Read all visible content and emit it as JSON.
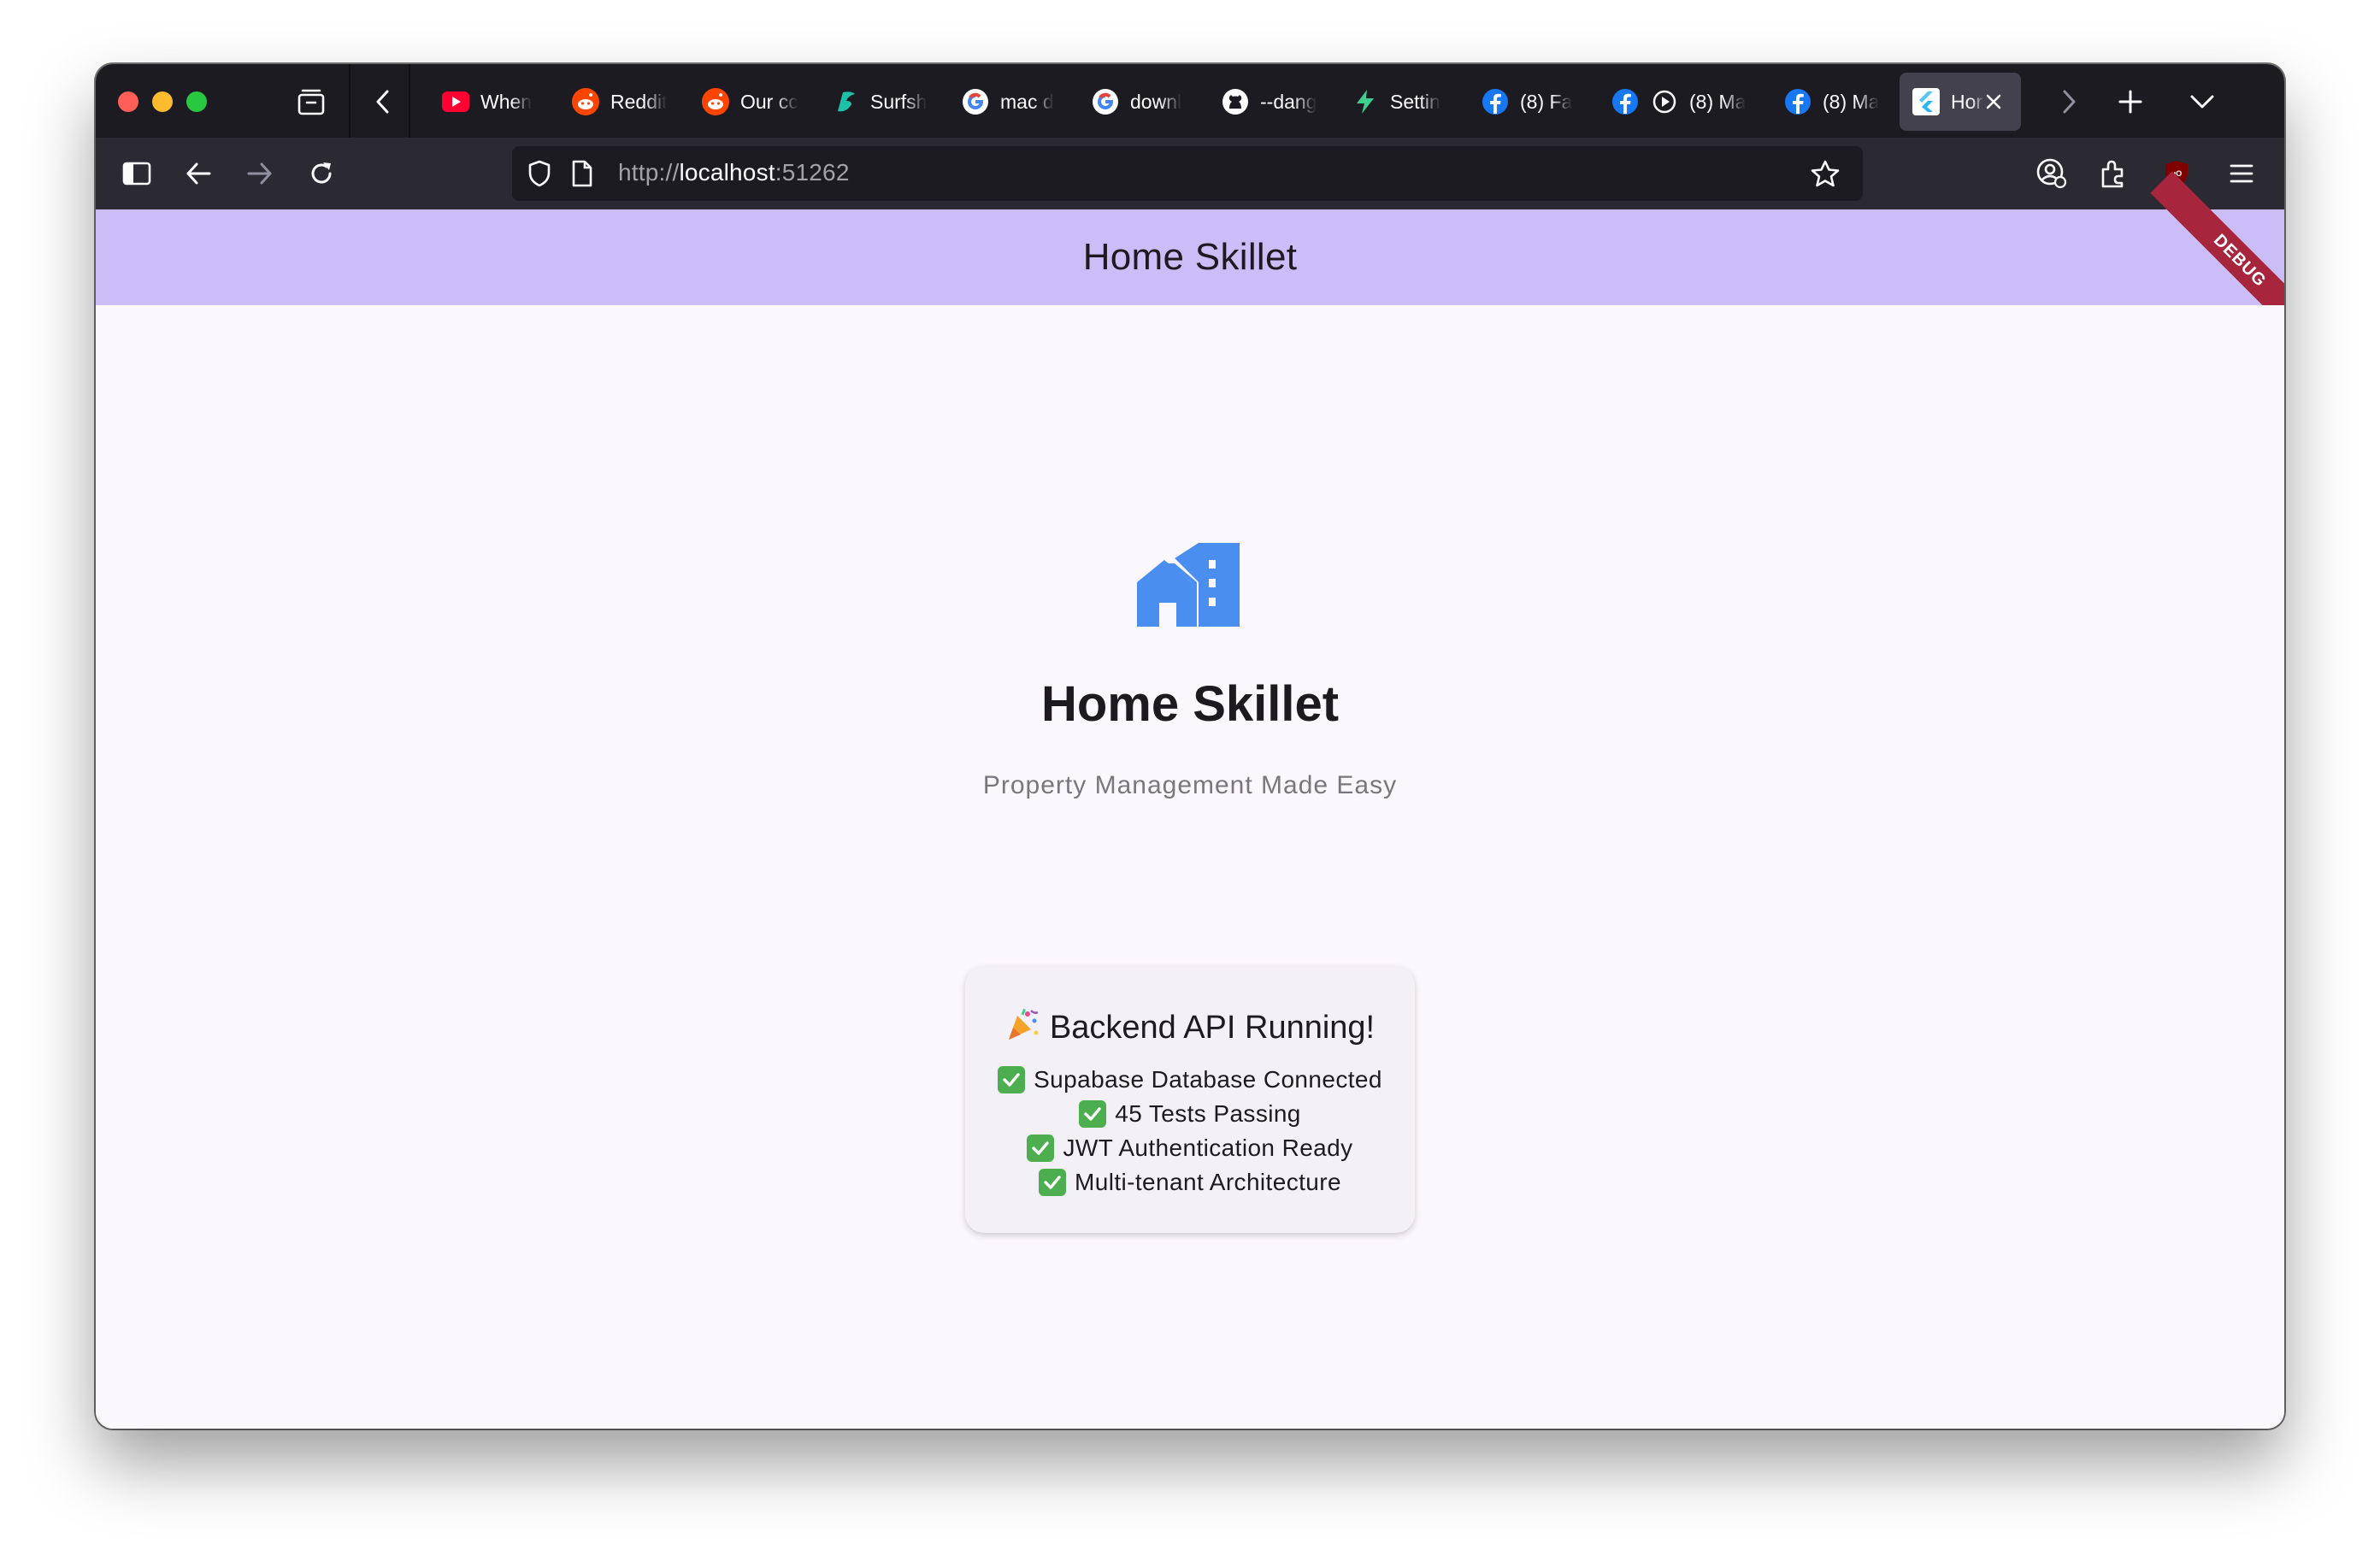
{
  "browser": {
    "tabs": [
      {
        "label": "When",
        "icon": "youtube-icon"
      },
      {
        "label": "Reddit",
        "icon": "reddit-icon"
      },
      {
        "label": "Our cc",
        "icon": "reddit-icon"
      },
      {
        "label": "Surfsh",
        "icon": "surfshark-icon"
      },
      {
        "label": "mac d",
        "icon": "google-icon"
      },
      {
        "label": "downl",
        "icon": "google-icon"
      },
      {
        "label": "--dang",
        "icon": "github-icon"
      },
      {
        "label": "Settin",
        "icon": "bolt-icon"
      },
      {
        "label": "(8) Fa",
        "icon": "facebook-icon"
      },
      {
        "label": "(8) Ma",
        "icon": "facebook-icon"
      },
      {
        "label": "(8) Ma",
        "icon": "facebook-icon"
      },
      {
        "label": "Hor",
        "icon": "flutter-icon",
        "active": true
      }
    ],
    "url": {
      "scheme": "http://",
      "host": "localhost",
      "port": ":51262"
    }
  },
  "app": {
    "appbar_title": "Home Skillet",
    "debug_banner": "DEBUG",
    "hero_title": "Home Skillet",
    "hero_subtitle": "Property Management Made Easy",
    "status_card": {
      "title": "Backend API Running!",
      "items": [
        "Supabase Database Connected",
        "45 Tests Passing",
        "JWT Authentication Ready",
        "Multi-tenant Architecture"
      ]
    }
  },
  "colors": {
    "appbar": "#cbbef8",
    "logo": "#4a8ff0",
    "debug": "#a8263d",
    "check": "#4cae4f"
  }
}
